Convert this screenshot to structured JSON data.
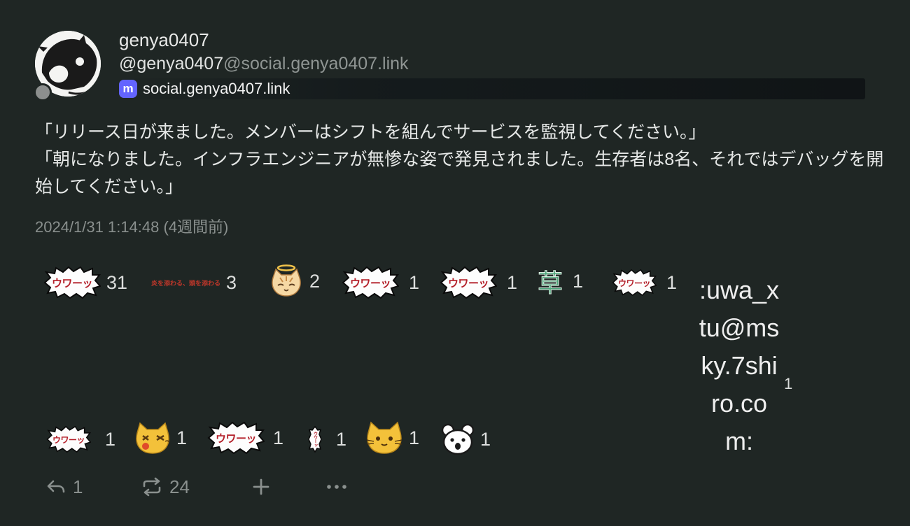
{
  "author": {
    "display_name": "genya0407",
    "username": "@genya0407",
    "host": "@social.genya0407.link",
    "instance_name": "social.genya0407.link",
    "instance_icon": "mastodon-icon"
  },
  "note": {
    "lines": [
      "「リリース日が来ました。メンバーはシフトを組んでサービスを監視してください。」",
      "「朝になりました。インフラエンジニアが無惨な姿で発見されました。生存者は8名、それではデバッグを開始してください。」"
    ],
    "timestamp": "2024/1/31 1:14:48 (4週間前)"
  },
  "reactions": {
    "r1": {
      "label": "ウワーッ",
      "count": "31"
    },
    "r2": {
      "label": "炎を添わる、頭を添わる",
      "count": "3"
    },
    "r3": {
      "icon": "angel-cat-icon",
      "count": "2"
    },
    "r4": {
      "label": "ウワーッ",
      "count": "1"
    },
    "r5": {
      "label": "ウワーッ",
      "count": "1"
    },
    "r6": {
      "label": "草",
      "count": "1"
    },
    "r7": {
      "label": "ウワーッ",
      "count": "1"
    },
    "r8": {
      "label": ":uwa_xtu@msky.7shiro.com:",
      "count": "1"
    },
    "r9": {
      "label": "ウワーッ",
      "count": "1"
    },
    "r10": {
      "icon": "dizzy-cat-icon",
      "count": "1"
    },
    "r11": {
      "label": "ウワーッ",
      "count": "1"
    },
    "r12": {
      "label": "ウワーッ",
      "count": "1"
    },
    "r13": {
      "icon": "cat-face-icon",
      "count": "1"
    },
    "r14": {
      "icon": "bear-face-icon",
      "count": "1"
    }
  },
  "footer": {
    "reply_count": "1",
    "renote_count": "24"
  },
  "colors": {
    "background": "#1f2624",
    "muted": "#8a908e",
    "accent_mastodon": "#6364ff",
    "burst_text": "#b4202a"
  }
}
